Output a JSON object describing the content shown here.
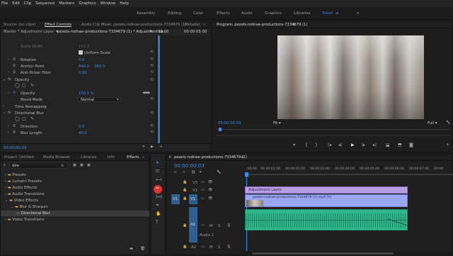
{
  "menu": [
    "File",
    "Edit",
    "Clip",
    "Sequence",
    "Markers",
    "Graphics",
    "Window",
    "Help"
  ],
  "workspaces": {
    "items": [
      "Assembly",
      "Editing",
      "Color",
      "Effects",
      "Audio",
      "Graphics",
      "Libraries",
      "Tutori"
    ],
    "more": "»"
  },
  "effect_controls": {
    "tabs": [
      "Source: (no clips)",
      "Effect Controls",
      "Audio Clip Mixer: pexels-rodnae-productions-7334679 (1)",
      "Metadat"
    ],
    "more": "»",
    "master": "Master * Adjustment Layer",
    "clip": "pexels-rodnae-productions-7334679 (1) * Adjustment La...",
    "ruler_start": "00:00",
    "ruler_end": "00:00:05:00",
    "rows": {
      "scale_width": "Scale Width",
      "scale_width_val": "100.0",
      "uniform_scale": "Uniform Scale",
      "rotation": "Rotation",
      "rotation_val": "0.0",
      "anchor": "Anchor Point",
      "anchor_x": "640.0",
      "anchor_y": "360.0",
      "antiflicker": "Anti-flicker Filter",
      "antiflicker_val": "0.00",
      "opacity_header": "Opacity",
      "opacity": "Opacity",
      "opacity_val": "100.0 %",
      "blend": "Blend Mode",
      "blend_val": "Normal",
      "time_remap": "Time Remapping",
      "dir_blur": "Directional Blur",
      "direction": "Direction",
      "direction_val": "0.0",
      "blur_len": "Blur Length",
      "blur_len_val": "40.0"
    },
    "timecode": "00:00:00:03"
  },
  "program": {
    "title": "Program: pexels-rodnae-productions-7334679 (1)",
    "more": "≡",
    "timecode": "00:00:00:03",
    "fit": "Fit",
    "full": "Full"
  },
  "project": {
    "tabs": [
      "Project: Untitled",
      "Media Browser",
      "Libraries",
      "Info",
      "Effects"
    ],
    "more": "»",
    "search": "dire",
    "items": [
      "Presets",
      "Lumetri Presets",
      "Audio Effects",
      "Audio Transitions",
      "Video Effects",
      "Blur & Sharpen",
      "Directional Blur",
      "Video Transitions"
    ]
  },
  "timeline": {
    "title": "pexels-rodnae-productions-7334679 (1)",
    "timecode": "00:00:00:03",
    "ruler": [
      ":00:00",
      "00:00:01:00",
      "00:00:02:00",
      "00:00:03:00",
      "00:00:04:00",
      "00:00:05:00",
      "00:00:06:00",
      "00:00:07:00",
      "00:00"
    ],
    "tracks": {
      "v3": "V3",
      "v2": "V2",
      "v1": "V1",
      "v1_src": "V1",
      "a1": "A1",
      "a1_src": "A1",
      "a2": "A2",
      "a1_name": "Audio 1"
    },
    "clips": {
      "adjustment": "Adjustment Layer",
      "video": "pexels-rodnae-productions-7334679 (1).mp4 [V]"
    },
    "m": "M",
    "s": "S"
  },
  "colors": {
    "accent": "#3b8cf0",
    "video_clip": "#9aa7f0",
    "audio_clip": "#2fb88b",
    "adjustment": "#b79de6"
  }
}
